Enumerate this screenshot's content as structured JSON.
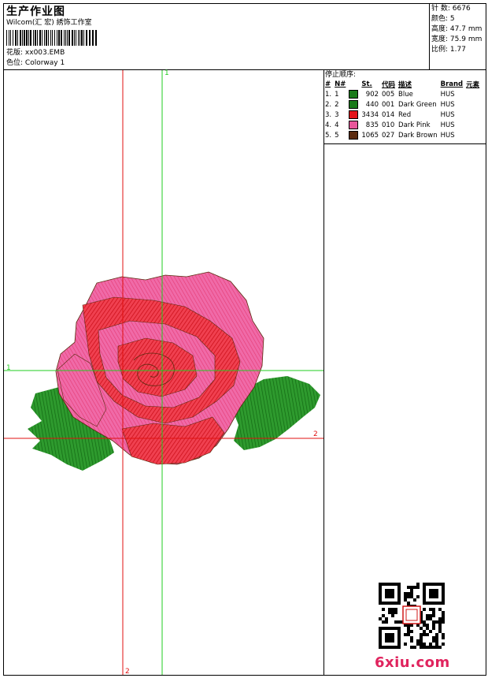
{
  "header": {
    "title": "生产作业图",
    "studio": "Wilcom(汇 宏) 綉饰工作室",
    "design_label": "花版:",
    "design_value": "xx003.EMB",
    "colorway_label": "色位:",
    "colorway_value": "Colorway 1"
  },
  "stats": {
    "stitches_label": "针 数:",
    "stitches_value": "6676",
    "colors_label": "颜色:",
    "colors_value": "5",
    "height_label": "高度:",
    "height_value": "47.7 mm",
    "width_label": "宽度:",
    "width_value": "75.9 mm",
    "ratio_label": "比例:",
    "ratio_value": "1.77"
  },
  "stop_sequence": {
    "title": "停止顺序:",
    "headers": [
      "#",
      "N#",
      "",
      "St.",
      "代码",
      "描述",
      "Brand",
      "元素"
    ],
    "rows": [
      {
        "index": "1.",
        "n": "1",
        "color": "#1a7a1a",
        "stitches": "902",
        "code": "005",
        "desc": "Blue",
        "brand": "HUS"
      },
      {
        "index": "2.",
        "n": "2",
        "color": "#1a7a1a",
        "stitches": "440",
        "code": "001",
        "desc": "Dark Green",
        "brand": "HUS"
      },
      {
        "index": "3.",
        "n": "3",
        "color": "#e3141b",
        "stitches": "3434",
        "code": "014",
        "desc": "Red",
        "brand": "HUS"
      },
      {
        "index": "4.",
        "n": "4",
        "color": "#e8569a",
        "stitches": "835",
        "code": "010",
        "desc": "Dark Pink",
        "brand": "HUS"
      },
      {
        "index": "5.",
        "n": "5",
        "color": "#5a2a0e",
        "stitches": "1065",
        "code": "027",
        "desc": "Dark Brown",
        "brand": "HUS"
      }
    ]
  },
  "canvas": {
    "guide_green_label_top": "1",
    "guide_green_label_left": "1",
    "guide_red_label_right": "2",
    "guide_red_label_bottom": "2"
  },
  "watermark": {
    "text": "6xiu.com",
    "color": "#e0245e"
  },
  "colors": {
    "guide_green": "#22cc22",
    "guide_red": "#e01010",
    "rose_red": "#e3141b",
    "rose_pink": "#e8569a",
    "leaf_green": "#1a7a1a",
    "outline_brown": "#5a2a0e"
  }
}
